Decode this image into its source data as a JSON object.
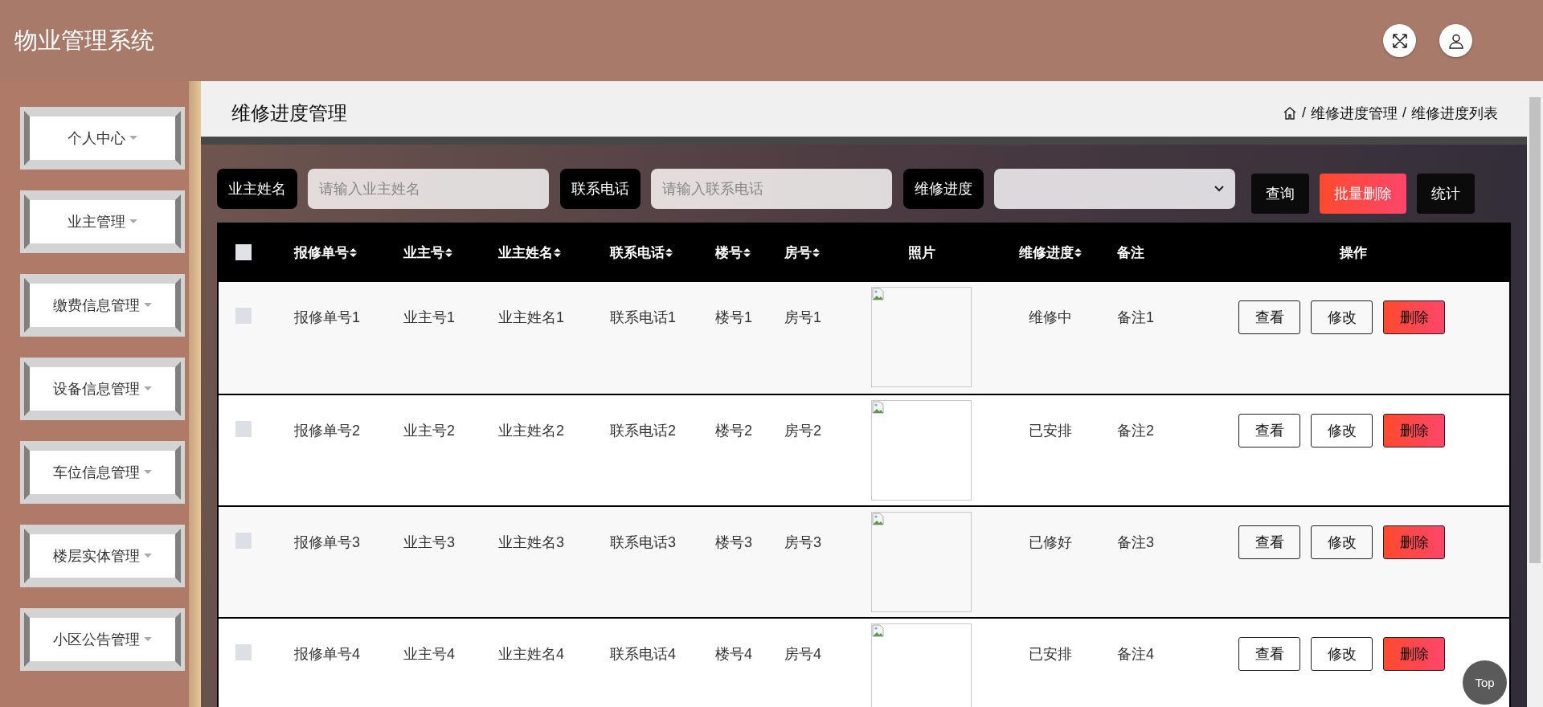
{
  "app_title": "物业管理系统",
  "header_actions": [
    {
      "kind": "fullscreen"
    },
    {
      "kind": "user"
    }
  ],
  "sidebar": {
    "items": [
      {
        "label": "个人中心"
      },
      {
        "label": "业主管理"
      },
      {
        "label": "缴费信息管理"
      },
      {
        "label": "设备信息管理"
      },
      {
        "label": "车位信息管理"
      },
      {
        "label": "楼层实体管理"
      },
      {
        "label": "小区公告管理"
      }
    ]
  },
  "page": {
    "title": "维修进度管理",
    "breadcrumb": {
      "separator": "/",
      "items": [
        "维修进度管理",
        "维修进度列表"
      ]
    }
  },
  "search": {
    "fields": [
      {
        "kind": "text",
        "label": "业主姓名",
        "placeholder": "请输入业主姓名"
      },
      {
        "kind": "text",
        "label": "联系电话",
        "placeholder": "请输入联系电话"
      },
      {
        "kind": "select",
        "label": "维修进度"
      }
    ],
    "buttons": [
      {
        "label": "查询",
        "kind": "default"
      },
      {
        "label": "批量删除",
        "kind": "danger"
      },
      {
        "label": "统计",
        "kind": "default"
      }
    ]
  },
  "table": {
    "select_all": {
      "checked": false
    },
    "columns": [
      {
        "label": "报修单号",
        "sortable": true
      },
      {
        "label": "业主号",
        "sortable": true
      },
      {
        "label": "业主姓名",
        "sortable": true
      },
      {
        "label": "联系电话",
        "sortable": true
      },
      {
        "label": "楼号",
        "sortable": true
      },
      {
        "label": "房号",
        "sortable": true
      },
      {
        "label": "照片",
        "sortable": false
      },
      {
        "label": "维修进度",
        "sortable": true
      },
      {
        "label": "备注",
        "sortable": false
      },
      {
        "label": "操作",
        "sortable": false
      }
    ],
    "rows": [
      {
        "checked": false,
        "repair_no": "报修单号1",
        "owner_no": "业主号1",
        "owner_name": "业主姓名1",
        "phone": "联系电话1",
        "building": "楼号1",
        "room": "房号1",
        "photo": {
          "kind": "broken-image"
        },
        "progress": "维修中",
        "remark": "备注1",
        "actions": [
          {
            "label": "查看",
            "kind": "default"
          },
          {
            "label": "修改",
            "kind": "default"
          },
          {
            "label": "删除",
            "kind": "danger"
          }
        ]
      },
      {
        "checked": false,
        "repair_no": "报修单号2",
        "owner_no": "业主号2",
        "owner_name": "业主姓名2",
        "phone": "联系电话2",
        "building": "楼号2",
        "room": "房号2",
        "photo": {
          "kind": "broken-image"
        },
        "progress": "已安排",
        "remark": "备注2",
        "actions": [
          {
            "label": "查看",
            "kind": "default"
          },
          {
            "label": "修改",
            "kind": "default"
          },
          {
            "label": "删除",
            "kind": "danger"
          }
        ]
      },
      {
        "checked": false,
        "repair_no": "报修单号3",
        "owner_no": "业主号3",
        "owner_name": "业主姓名3",
        "phone": "联系电话3",
        "building": "楼号3",
        "room": "房号3",
        "photo": {
          "kind": "broken-image"
        },
        "progress": "已修好",
        "remark": "备注3",
        "actions": [
          {
            "label": "查看",
            "kind": "default"
          },
          {
            "label": "修改",
            "kind": "default"
          },
          {
            "label": "删除",
            "kind": "danger"
          }
        ]
      },
      {
        "checked": false,
        "repair_no": "报修单号4",
        "owner_no": "业主号4",
        "owner_name": "业主姓名4",
        "phone": "联系电话4",
        "building": "楼号4",
        "room": "房号4",
        "photo": {
          "kind": "broken-image"
        },
        "progress": "已安排",
        "remark": "备注4",
        "actions": [
          {
            "label": "查看",
            "kind": "default"
          },
          {
            "label": "修改",
            "kind": "default"
          },
          {
            "label": "删除",
            "kind": "danger"
          }
        ]
      }
    ]
  },
  "back_to_top": {
    "label": "Top"
  }
}
